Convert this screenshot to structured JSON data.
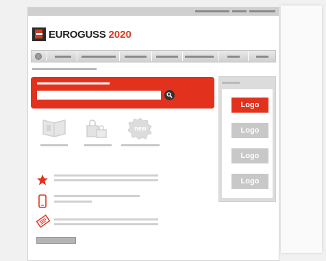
{
  "colors": {
    "accent": "#e2321e",
    "logo_dark": "#2c2c2c"
  },
  "brand": {
    "name": "EUROGUSS",
    "year": "2020"
  },
  "sidebar": {
    "logos": [
      {
        "label": "Logo",
        "state": "active"
      },
      {
        "label": "Logo",
        "state": "inactive"
      },
      {
        "label": "Logo",
        "state": "inactive"
      },
      {
        "label": "Logo",
        "state": "inactive"
      }
    ]
  },
  "features": [
    {
      "icon": "map-board-icon"
    },
    {
      "icon": "shopping-bags-icon"
    },
    {
      "icon": "new-badge-icon",
      "badge_text": "new"
    }
  ],
  "list_items": [
    {
      "icon": "star-icon"
    },
    {
      "icon": "mobile-phone-icon"
    },
    {
      "icon": "ticket-icon"
    }
  ]
}
